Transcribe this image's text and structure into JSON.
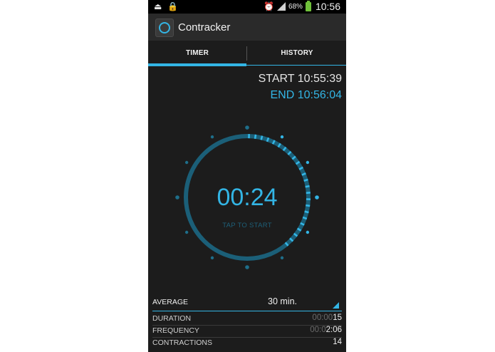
{
  "status_bar": {
    "battery_percent": "68%",
    "time": "10:56",
    "icons": [
      "usb-icon",
      "lock-icon",
      "alarm-icon",
      "signal-icon",
      "battery-charging-icon"
    ]
  },
  "app": {
    "title": "Contracker"
  },
  "tabs": [
    {
      "label": "TIMER",
      "selected": true
    },
    {
      "label": "HISTORY",
      "selected": false
    }
  ],
  "session": {
    "start": "START 10:55:39",
    "end": "END 10:56:04"
  },
  "timer": {
    "display": "00:24",
    "hint": "TAP TO START",
    "progress_fraction": 0.4
  },
  "average": {
    "label": "AVERAGE",
    "value": "30 min."
  },
  "stats": [
    {
      "label": "DURATION",
      "value_dim": "00:00",
      "value": "15"
    },
    {
      "label": "FREQUENCY",
      "value_dim": "00:0",
      "value": "2:06"
    },
    {
      "label": "CONTRACTIONS",
      "value_dim": "",
      "value": "14"
    }
  ],
  "colors": {
    "accent": "#33b5e5",
    "background": "#1c1c1c",
    "ring": "#1b5f78"
  }
}
